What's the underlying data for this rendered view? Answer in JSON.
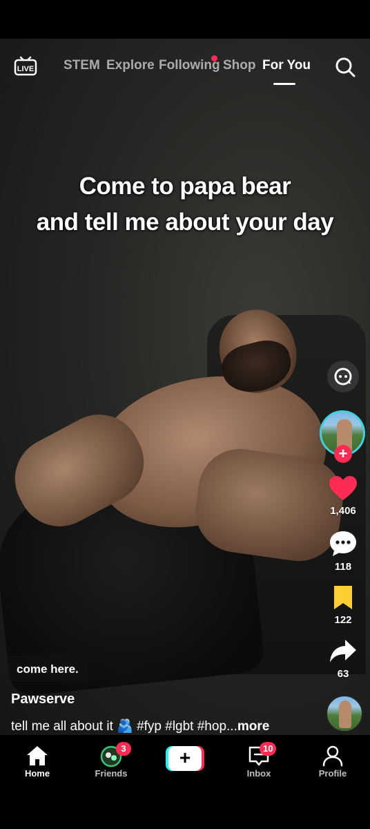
{
  "topnav": {
    "live_label": "LIVE",
    "tabs": [
      {
        "label": "STEM",
        "active": false
      },
      {
        "label": "Explore",
        "active": false
      },
      {
        "label": "Following",
        "active": false,
        "has_dot": true
      },
      {
        "label": "Shop",
        "active": false
      },
      {
        "label": "For You",
        "active": true
      }
    ],
    "search_icon": "search-icon"
  },
  "video": {
    "caption_line1": "Come to papa bear",
    "caption_line2": "and tell me about your day",
    "overlay_caption": "come here."
  },
  "rail": {
    "likes": "1,406",
    "comments": "118",
    "saves": "122",
    "shares": "63",
    "colors": {
      "like": "#fe2c55",
      "save": "#fcd033",
      "follow": "#fe2c55",
      "ring": "#3fd0e0"
    }
  },
  "post": {
    "username": "Pawserve",
    "description": "tell me all about it 🫂 #fyp #lgbt #hop...",
    "more_label": "more"
  },
  "bottomnav": {
    "home": "Home",
    "friends": "Friends",
    "friends_badge": "3",
    "inbox": "Inbox",
    "inbox_badge": "10",
    "profile": "Profile",
    "create_label": "+"
  }
}
